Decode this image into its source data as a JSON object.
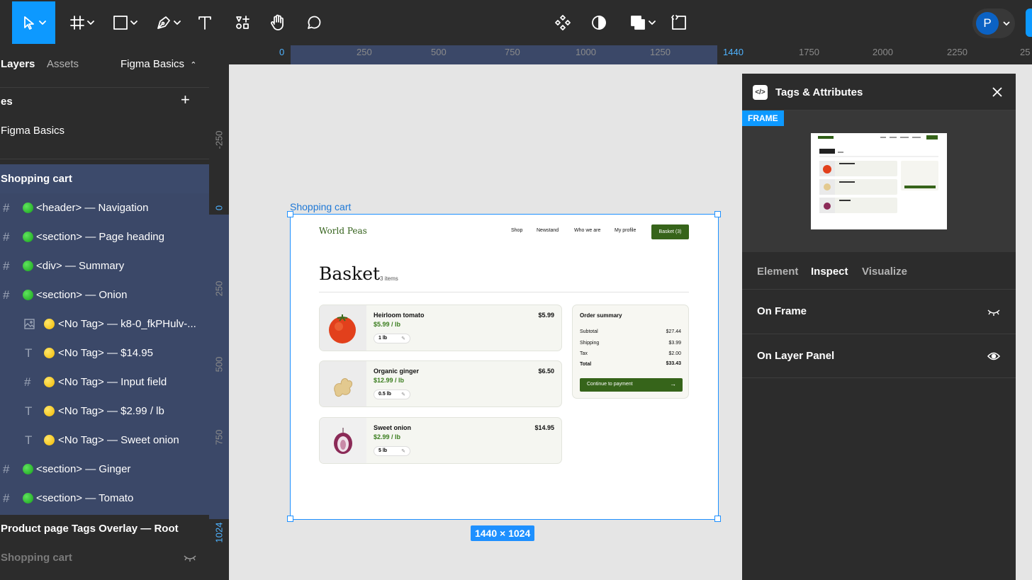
{
  "toolbar": {
    "tools": [
      "move-tool",
      "frame-tool",
      "shape-tool",
      "pen-tool",
      "text-tool",
      "resources-tool",
      "hand-tool",
      "comment-tool"
    ],
    "center_tools": [
      "components-icon",
      "contrast-icon",
      "boolean-icon",
      "dev-mode-icon"
    ],
    "avatar_initial": "P"
  },
  "left_panel": {
    "tabs": {
      "layers": "Layers",
      "assets": "Assets"
    },
    "page_selector": "Figma Basics",
    "pages_heading": "es",
    "current_page": "Figma Basics",
    "layers": [
      {
        "label": "Shopping cart",
        "type": "frame",
        "selected": true
      },
      {
        "label": "<header> — Navigation",
        "dot": "green"
      },
      {
        "label": "<section> — Page heading",
        "dot": "green"
      },
      {
        "label": "<div> — Summary",
        "dot": "green"
      },
      {
        "label": "<section> — Onion",
        "dot": "green"
      },
      {
        "label": "<No Tag> — k8-0_fkPHulv-...",
        "dot": "yellow",
        "icon": "image"
      },
      {
        "label": "<No Tag> — $14.95",
        "dot": "yellow",
        "icon": "text"
      },
      {
        "label": "<No Tag> — Input field",
        "dot": "yellow",
        "icon": "frame"
      },
      {
        "label": "<No Tag> — $2.99 / lb",
        "dot": "yellow",
        "icon": "text"
      },
      {
        "label": "<No Tag> — Sweet onion",
        "dot": "yellow",
        "icon": "text"
      },
      {
        "label": "<section> — Ginger",
        "dot": "green"
      },
      {
        "label": "<section> — Tomato",
        "dot": "green"
      },
      {
        "label": "Product page Tags Overlay — Root",
        "type": "root"
      },
      {
        "label": "Shopping cart",
        "type": "hidden"
      }
    ]
  },
  "rulers": {
    "top": [
      "0",
      "250",
      "500",
      "750",
      "1000",
      "1250",
      "1440",
      "1750",
      "2000",
      "2250",
      "25"
    ],
    "left": [
      "-250",
      "0",
      "250",
      "500",
      "750",
      "1024"
    ]
  },
  "canvas": {
    "frame_label": "Shopping cart",
    "frame_size": "1440 × 1024"
  },
  "site": {
    "brand": "World Peas",
    "nav": [
      "Shop",
      "Newstand",
      "Who we are",
      "My profile"
    ],
    "basket_button": "Basket (3)",
    "heading": "Basket",
    "item_count": "3 items",
    "items": [
      {
        "name": "Heirloom tomato",
        "unit_price": "$5.99 / lb",
        "qty": "1 lb",
        "total": "$5.99",
        "image": "tomato"
      },
      {
        "name": "Organic ginger",
        "unit_price": "$12.99 / lb",
        "qty": "0.5 lb",
        "total": "$6.50",
        "image": "ginger"
      },
      {
        "name": "Sweet onion",
        "unit_price": "$2.99 / lb",
        "qty": "5 lb",
        "total": "$14.95",
        "image": "onion"
      }
    ],
    "summary": {
      "title": "Order summary",
      "rows": [
        {
          "label": "Subtotal",
          "value": "$27.44"
        },
        {
          "label": "Shipping",
          "value": "$3.99"
        },
        {
          "label": "Tax",
          "value": "$2.00"
        },
        {
          "label": "Total",
          "value": "$33.43"
        }
      ],
      "cta": "Continue to payment"
    }
  },
  "right_panel": {
    "title": "Tags & Attributes",
    "badge": "FRAME",
    "tabs": {
      "element": "Element",
      "inspect": "Inspect",
      "visualize": "Visualize"
    },
    "rows": [
      {
        "label": "On Frame",
        "icon": "eye-closed-icon"
      },
      {
        "label": "On Layer Panel",
        "icon": "eye-icon"
      }
    ]
  },
  "colors": {
    "selection_blue": "#1e90ff",
    "ui_dark": "#2c2c2c",
    "site_green": "#3a6b1f",
    "tag_green": "#22b02a",
    "tag_yellow": "#f5c400"
  }
}
